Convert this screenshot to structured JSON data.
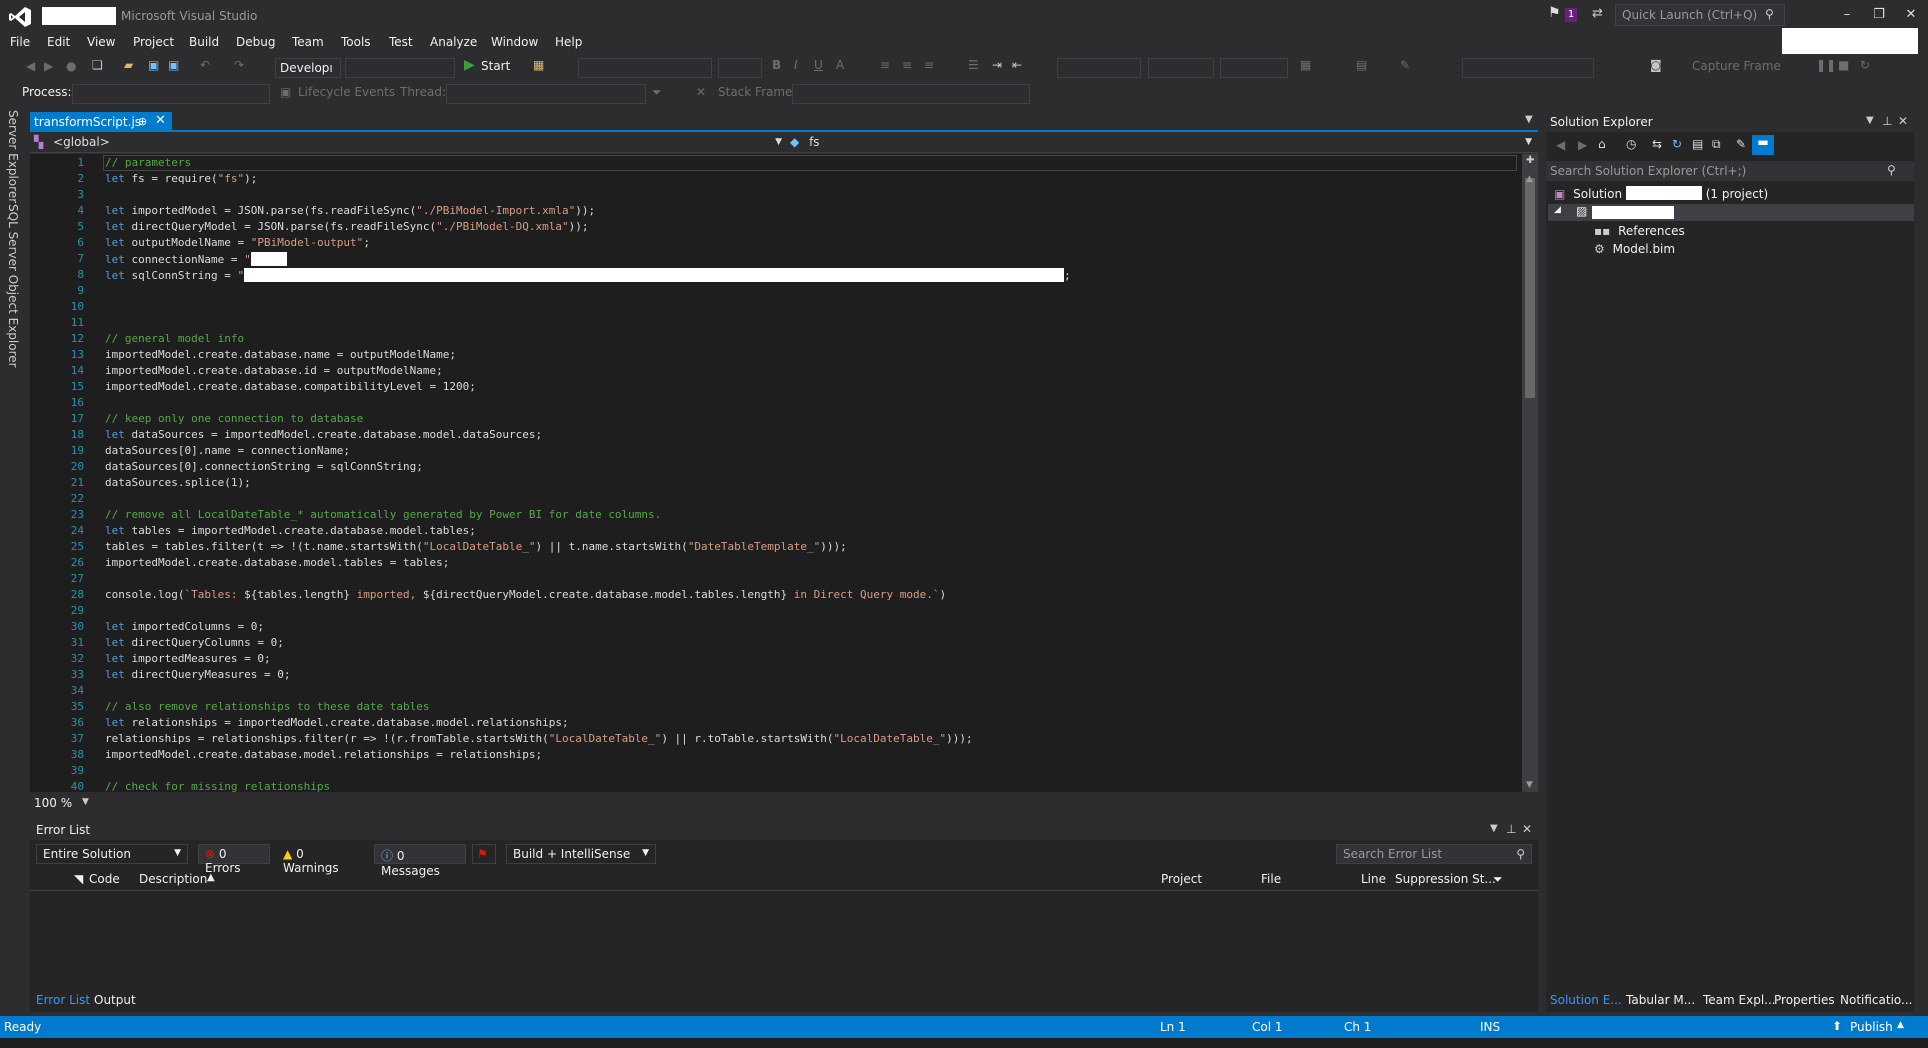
{
  "window": {
    "title": "Microsoft Visual Studio",
    "quick_launch_placeholder": "Quick Launch (Ctrl+Q)",
    "notification_count": "1"
  },
  "menu": [
    "File",
    "Edit",
    "View",
    "Project",
    "Build",
    "Debug",
    "Team",
    "Tools",
    "Test",
    "Analyze",
    "Window",
    "Help"
  ],
  "toolbar": {
    "config": "Developı",
    "start_label": "Start",
    "capture_frame": "Capture Frame",
    "process_label": "Process:",
    "lifecycle_label": "Lifecycle Events",
    "thread_label": "Thread:",
    "stack_frame_label": "Stack Frame:"
  },
  "left_rail": [
    "Server Explorer",
    "SQL Server Object Explorer"
  ],
  "editor": {
    "tab_title": "transformScript.js",
    "nav_scope": "<global>",
    "nav_member": "fs",
    "zoom": "100 %",
    "lines": [
      {
        "n": "1",
        "parts": [
          {
            "t": "// parameters",
            "c": "cm"
          }
        ]
      },
      {
        "n": "2",
        "parts": [
          {
            "t": "let",
            "c": "kw"
          },
          {
            "t": " fs = require(",
            "c": ""
          },
          {
            "t": "\"fs\"",
            "c": "st"
          },
          {
            "t": ");",
            "c": ""
          }
        ]
      },
      {
        "n": "3",
        "parts": []
      },
      {
        "n": "4",
        "parts": [
          {
            "t": "let",
            "c": "kw"
          },
          {
            "t": " importedModel = JSON.parse(fs.readFileSync(",
            "c": ""
          },
          {
            "t": "\"./PBiModel-Import.xmla\"",
            "c": "st"
          },
          {
            "t": "));",
            "c": ""
          }
        ]
      },
      {
        "n": "5",
        "parts": [
          {
            "t": "let",
            "c": "kw"
          },
          {
            "t": " directQueryModel = JSON.parse(fs.readFileSync(",
            "c": ""
          },
          {
            "t": "\"./PBiModel-DQ.xmla\"",
            "c": "st"
          },
          {
            "t": "));",
            "c": ""
          }
        ]
      },
      {
        "n": "6",
        "parts": [
          {
            "t": "let",
            "c": "kw"
          },
          {
            "t": " outputModelName = ",
            "c": ""
          },
          {
            "t": "\"PBiModel-output\"",
            "c": "st"
          },
          {
            "t": ";",
            "c": ""
          }
        ]
      },
      {
        "n": "7",
        "parts": [
          {
            "t": "let",
            "c": "kw"
          },
          {
            "t": " connectionName = ",
            "c": ""
          },
          {
            "t": "\"",
            "c": "st"
          },
          {
            "t": "",
            "c": "redact",
            "w": 36
          }
        ]
      },
      {
        "n": "8",
        "parts": [
          {
            "t": "let",
            "c": "kw"
          },
          {
            "t": " sqlConnString = ",
            "c": ""
          },
          {
            "t": "\"",
            "c": "st"
          },
          {
            "t": "",
            "c": "redact",
            "w": 820
          },
          {
            "t": ";",
            "c": ""
          }
        ]
      },
      {
        "n": "9",
        "parts": []
      },
      {
        "n": "10",
        "parts": []
      },
      {
        "n": "11",
        "parts": []
      },
      {
        "n": "12",
        "parts": [
          {
            "t": "// general model info",
            "c": "cm"
          }
        ]
      },
      {
        "n": "13",
        "parts": [
          {
            "t": "importedModel.create.database.name = outputModelName;",
            "c": ""
          }
        ]
      },
      {
        "n": "14",
        "parts": [
          {
            "t": "importedModel.create.database.id = outputModelName;",
            "c": ""
          }
        ]
      },
      {
        "n": "15",
        "parts": [
          {
            "t": "importedModel.create.database.compatibilityLevel = 1200;",
            "c": ""
          }
        ]
      },
      {
        "n": "16",
        "parts": []
      },
      {
        "n": "17",
        "parts": [
          {
            "t": "// keep only one connection to database",
            "c": "cm"
          }
        ]
      },
      {
        "n": "18",
        "parts": [
          {
            "t": "let",
            "c": "kw"
          },
          {
            "t": " dataSources = importedModel.create.database.model.dataSources;",
            "c": ""
          }
        ]
      },
      {
        "n": "19",
        "parts": [
          {
            "t": "dataSources[0].name = connectionName;",
            "c": ""
          }
        ]
      },
      {
        "n": "20",
        "parts": [
          {
            "t": "dataSources[0].connectionString = sqlConnString;",
            "c": ""
          }
        ]
      },
      {
        "n": "21",
        "parts": [
          {
            "t": "dataSources.splice(1);",
            "c": ""
          }
        ]
      },
      {
        "n": "22",
        "parts": []
      },
      {
        "n": "23",
        "parts": [
          {
            "t": "// remove all LocalDateTable_* automatically generated by Power BI for date columns.",
            "c": "cm"
          }
        ]
      },
      {
        "n": "24",
        "parts": [
          {
            "t": "let",
            "c": "kw"
          },
          {
            "t": " tables = importedModel.create.database.model.tables;",
            "c": ""
          }
        ]
      },
      {
        "n": "25",
        "parts": [
          {
            "t": "tables = tables.filter(t => !(t.name.startsWith(",
            "c": ""
          },
          {
            "t": "\"LocalDateTable_\"",
            "c": "st"
          },
          {
            "t": ") || t.name.startsWith(",
            "c": ""
          },
          {
            "t": "\"DateTableTemplate_\"",
            "c": "st"
          },
          {
            "t": ")));",
            "c": ""
          }
        ]
      },
      {
        "n": "26",
        "parts": [
          {
            "t": "importedModel.create.database.model.tables = tables;",
            "c": ""
          }
        ]
      },
      {
        "n": "27",
        "parts": []
      },
      {
        "n": "28",
        "parts": [
          {
            "t": "console.log(",
            "c": ""
          },
          {
            "t": "`Tables: ",
            "c": "st"
          },
          {
            "t": "${tables.length}",
            "c": ""
          },
          {
            "t": " imported, ",
            "c": "st"
          },
          {
            "t": "${directQueryModel.create.database.model.tables.length}",
            "c": ""
          },
          {
            "t": " in Direct Query mode.`",
            "c": "st"
          },
          {
            "t": ")",
            "c": ""
          }
        ]
      },
      {
        "n": "29",
        "parts": []
      },
      {
        "n": "30",
        "parts": [
          {
            "t": "let",
            "c": "kw"
          },
          {
            "t": " importedColumns = 0;",
            "c": ""
          }
        ]
      },
      {
        "n": "31",
        "parts": [
          {
            "t": "let",
            "c": "kw"
          },
          {
            "t": " directQueryColumns = 0;",
            "c": ""
          }
        ]
      },
      {
        "n": "32",
        "parts": [
          {
            "t": "let",
            "c": "kw"
          },
          {
            "t": " importedMeasures = 0;",
            "c": ""
          }
        ]
      },
      {
        "n": "33",
        "parts": [
          {
            "t": "let",
            "c": "kw"
          },
          {
            "t": " directQueryMeasures = 0;",
            "c": ""
          }
        ]
      },
      {
        "n": "34",
        "parts": []
      },
      {
        "n": "35",
        "parts": [
          {
            "t": "// also remove relationships to these date tables",
            "c": "cm"
          }
        ]
      },
      {
        "n": "36",
        "parts": [
          {
            "t": "let",
            "c": "kw"
          },
          {
            "t": " relationships = importedModel.create.database.model.relationships;",
            "c": ""
          }
        ]
      },
      {
        "n": "37",
        "parts": [
          {
            "t": "relationships = relationships.filter(r => !(r.fromTable.startsWith(",
            "c": ""
          },
          {
            "t": "\"LocalDateTable_\"",
            "c": "st"
          },
          {
            "t": ") || r.toTable.startsWith(",
            "c": ""
          },
          {
            "t": "\"LocalDateTable_\"",
            "c": "st"
          },
          {
            "t": ")));",
            "c": ""
          }
        ]
      },
      {
        "n": "38",
        "parts": [
          {
            "t": "importedModel.create.database.model.relationships = relationships;",
            "c": ""
          }
        ]
      },
      {
        "n": "39",
        "parts": []
      },
      {
        "n": "40",
        "parts": [
          {
            "t": "// check for missing relationships",
            "c": "cm"
          }
        ]
      }
    ]
  },
  "error_list": {
    "title": "Error List",
    "scope": "Entire Solution",
    "errors": "0 Errors",
    "warnings": "0 Warnings",
    "messages": "0 Messages",
    "build_filter": "Build + IntelliSense",
    "search_placeholder": "Search Error List",
    "columns": [
      "Code",
      "Description",
      "Project",
      "File",
      "Line",
      "Suppression St..."
    ],
    "tabs": [
      "Error List",
      "Output"
    ]
  },
  "solution_explorer": {
    "title": "Solution Explorer",
    "search_placeholder": "Search Solution Explorer (Ctrl+;)",
    "solution_prefix": "Solution",
    "solution_suffix": "(1 project)",
    "items": [
      "References",
      "Model.bim"
    ],
    "tabs": [
      "Solution E...",
      "Tabular M...",
      "Team Expl...",
      "Properties",
      "Notificatio..."
    ]
  },
  "status": {
    "state": "Ready",
    "ln": "Ln 1",
    "col": "Col 1",
    "ch": "Ch 1",
    "mode": "INS",
    "publish": "Publish"
  },
  "colors": {
    "accent": "#007acc",
    "background": "#2d2d30",
    "editor": "#1e1e1e"
  }
}
